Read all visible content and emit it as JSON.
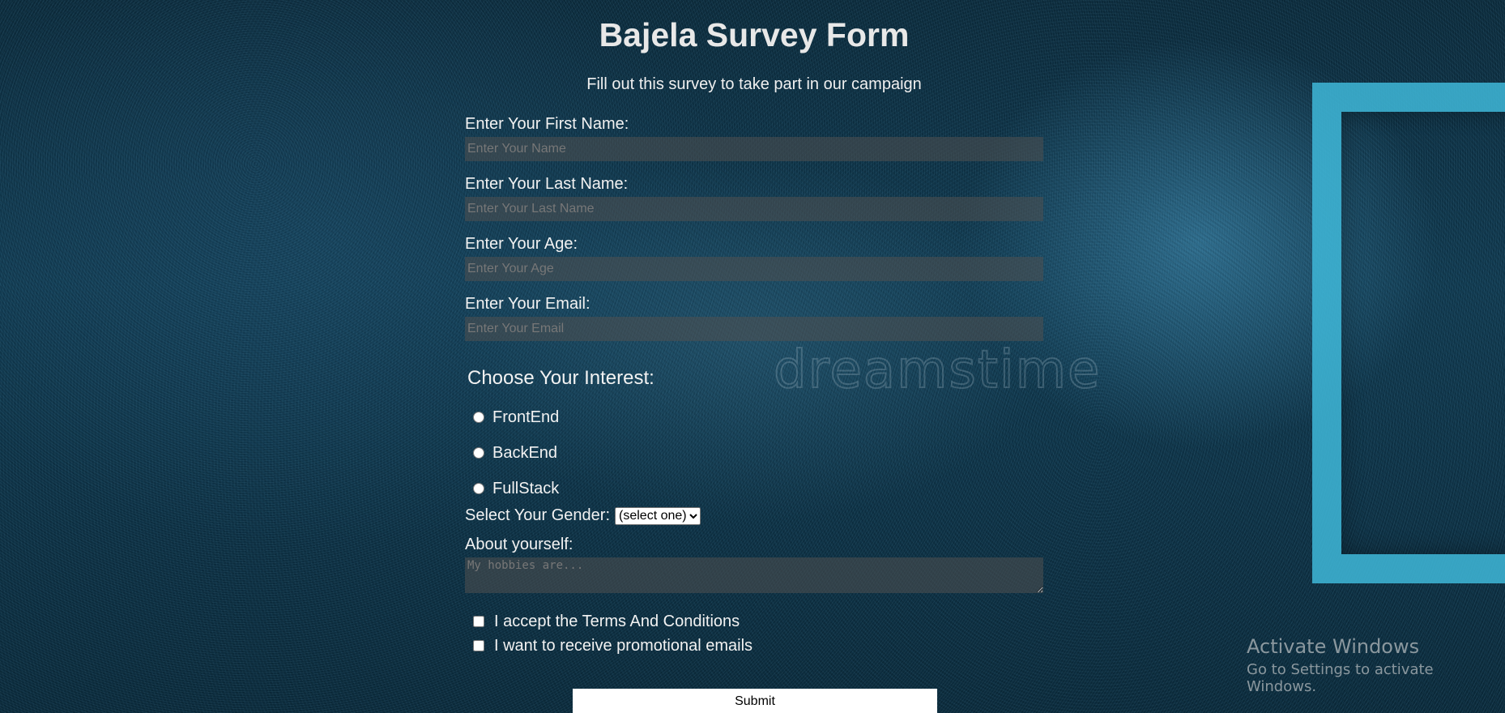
{
  "title": "Bajela Survey Form",
  "subtitle": "Fill out this survey to take part in our campaign",
  "fields": {
    "first_name": {
      "label": "Enter Your First Name:",
      "placeholder": "Enter Your Name",
      "value": ""
    },
    "last_name": {
      "label": "Enter Your Last Name:",
      "placeholder": "Enter Your Last Name",
      "value": ""
    },
    "age": {
      "label": "Enter Your Age:",
      "placeholder": "Enter Your Age",
      "value": ""
    },
    "email": {
      "label": "Enter Your Email:",
      "placeholder": "Enter Your Email",
      "value": ""
    }
  },
  "interest": {
    "title": "Choose Your Interest:",
    "options": [
      "FrontEnd",
      "BackEnd",
      "FullStack"
    ]
  },
  "gender": {
    "label": "Select Your Gender:",
    "selected": "(select one)"
  },
  "about": {
    "label": "About yourself:",
    "placeholder": "My hobbies are..."
  },
  "checkboxes": {
    "terms": "I accept the Terms And Conditions",
    "promo": "I want to receive promotional emails"
  },
  "submit_label": "Submit",
  "watermark": "dreamstime",
  "windows_activation": {
    "line1": "Activate Windows",
    "line2": "Go to Settings to activate Windows."
  }
}
